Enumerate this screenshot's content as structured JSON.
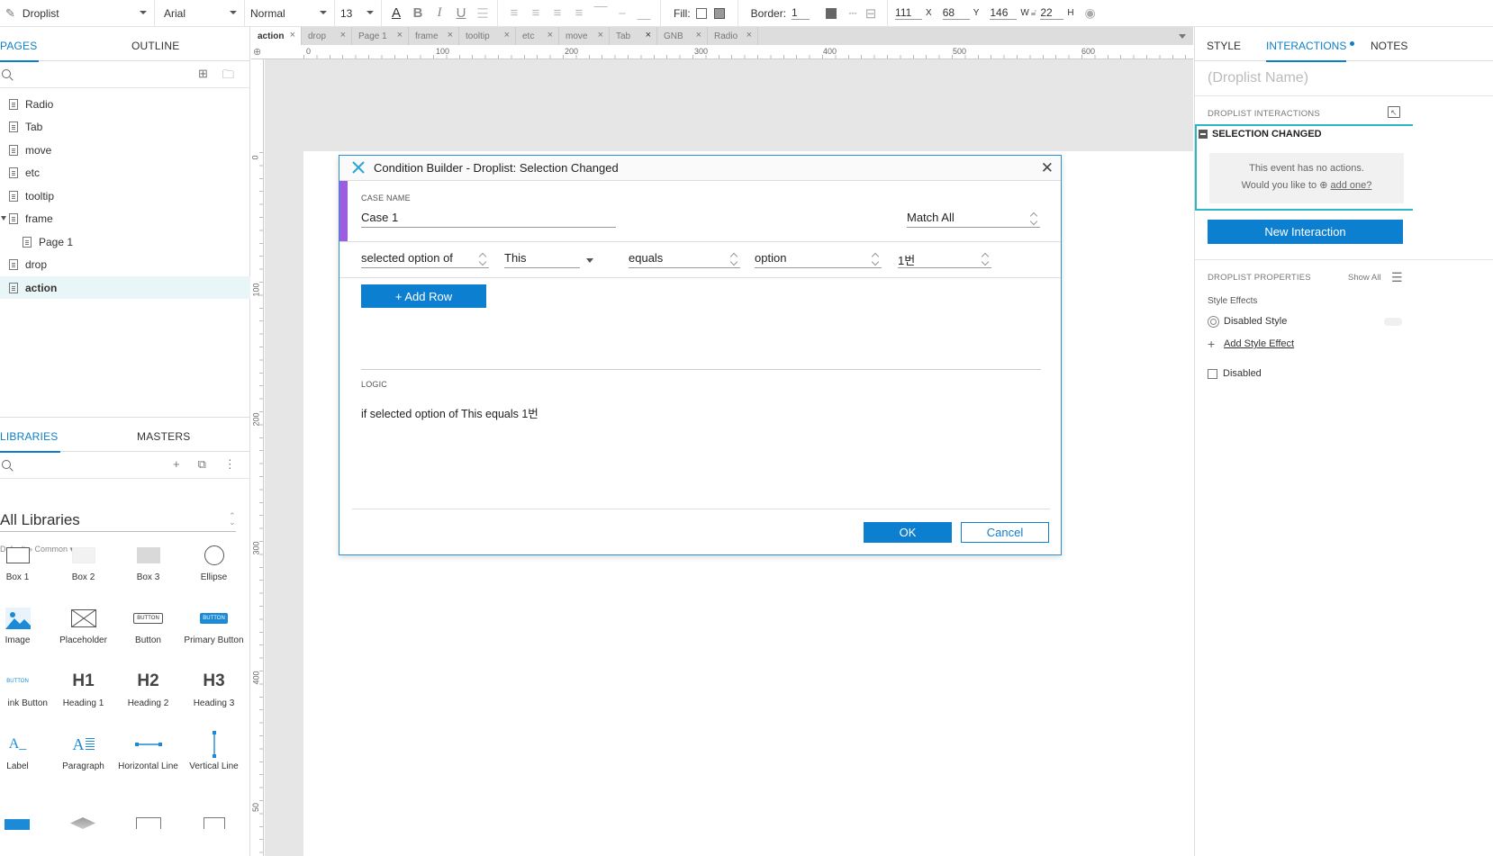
{
  "toolbar": {
    "widget_type": "Droplist",
    "font_family": "Arial",
    "font_style": "Normal",
    "font_size": "13",
    "fill_label": "Fill:",
    "border_label": "Border:",
    "border_value": "1",
    "x_value": "111",
    "x_label": "X",
    "y_value": "68",
    "y_label": "Y",
    "w_value": "146",
    "w_label": "W",
    "h_value": "22",
    "h_label": "H"
  },
  "left": {
    "tabs": [
      "PAGES",
      "OUTLINE"
    ],
    "pages": [
      {
        "label": "Radio"
      },
      {
        "label": "Tab"
      },
      {
        "label": "move"
      },
      {
        "label": "etc"
      },
      {
        "label": "tooltip"
      },
      {
        "label": "frame"
      },
      {
        "label": "Page 1"
      },
      {
        "label": "drop"
      },
      {
        "label": "action"
      }
    ],
    "lib_tabs": [
      "LIBRARIES",
      "MASTERS"
    ],
    "library_name": "All Libraries",
    "breadcrumb": "Default » Common ▾",
    "widgets": [
      {
        "label": "Box 1"
      },
      {
        "label": "Box 2"
      },
      {
        "label": "Box 3"
      },
      {
        "label": "Ellipse"
      },
      {
        "label": "Image"
      },
      {
        "label": "Placeholder"
      },
      {
        "label": "Button"
      },
      {
        "label": "Primary Button"
      },
      {
        "label": "ink Button"
      },
      {
        "label": "Heading 1"
      },
      {
        "label": "Heading 2"
      },
      {
        "label": "Heading 3"
      },
      {
        "label": "Label"
      },
      {
        "label": "Paragraph"
      },
      {
        "label": "Horizontal Line"
      },
      {
        "label": "Vertical Line"
      }
    ],
    "glyphs": {
      "button": "BUTTON",
      "primary": "BUTTON",
      "link": "BUTTON",
      "h1": "H1",
      "h2": "H2",
      "h3": "H3",
      "label_icon": "A_",
      "para_icon": "A"
    }
  },
  "canvas": {
    "tabs": [
      "action",
      "drop",
      "Page 1",
      "frame",
      "tooltip",
      "etc",
      "move",
      "Tab",
      "GNB",
      "Radio"
    ],
    "ruler_h": [
      "0",
      "100",
      "200",
      "300",
      "400",
      "500",
      "600"
    ],
    "ruler_v": [
      "0",
      "100",
      "200",
      "300",
      "400",
      "50"
    ]
  },
  "dialog": {
    "title": "Condition Builder  -  Droplist: Selection Changed",
    "case_name_label": "CASE NAME",
    "case_name": "Case 1",
    "match": "Match All",
    "condition": {
      "left": "selected option of",
      "target": "This",
      "operator": "equals",
      "value_type": "option",
      "value": "1번"
    },
    "add_row": "+ Add Row",
    "logic_label": "LOGIC",
    "logic_text": "if selected option of This equals 1번",
    "ok": "OK",
    "cancel": "Cancel"
  },
  "right": {
    "tabs": [
      "STYLE",
      "INTERACTIONS",
      "NOTES"
    ],
    "name_placeholder": "(Droplist Name)",
    "interactions_label": "DROPLIST INTERACTIONS",
    "event_name": "SELECTION CHANGED",
    "no_actions_line1": "This event has no actions.",
    "no_actions_line2": "Would you like to",
    "add_one": "add one?",
    "new_interaction": "New Interaction",
    "properties_label": "DROPLIST PROPERTIES",
    "show_all": "Show All",
    "style_effects_label": "Style Effects",
    "disabled_style": "Disabled Style",
    "add_style_effect": "Add Style Effect",
    "disabled": "Disabled"
  },
  "colors": {
    "accent_blue": "#0d7fd1",
    "teal": "#2db7c3",
    "purple": "#9c5de0"
  }
}
